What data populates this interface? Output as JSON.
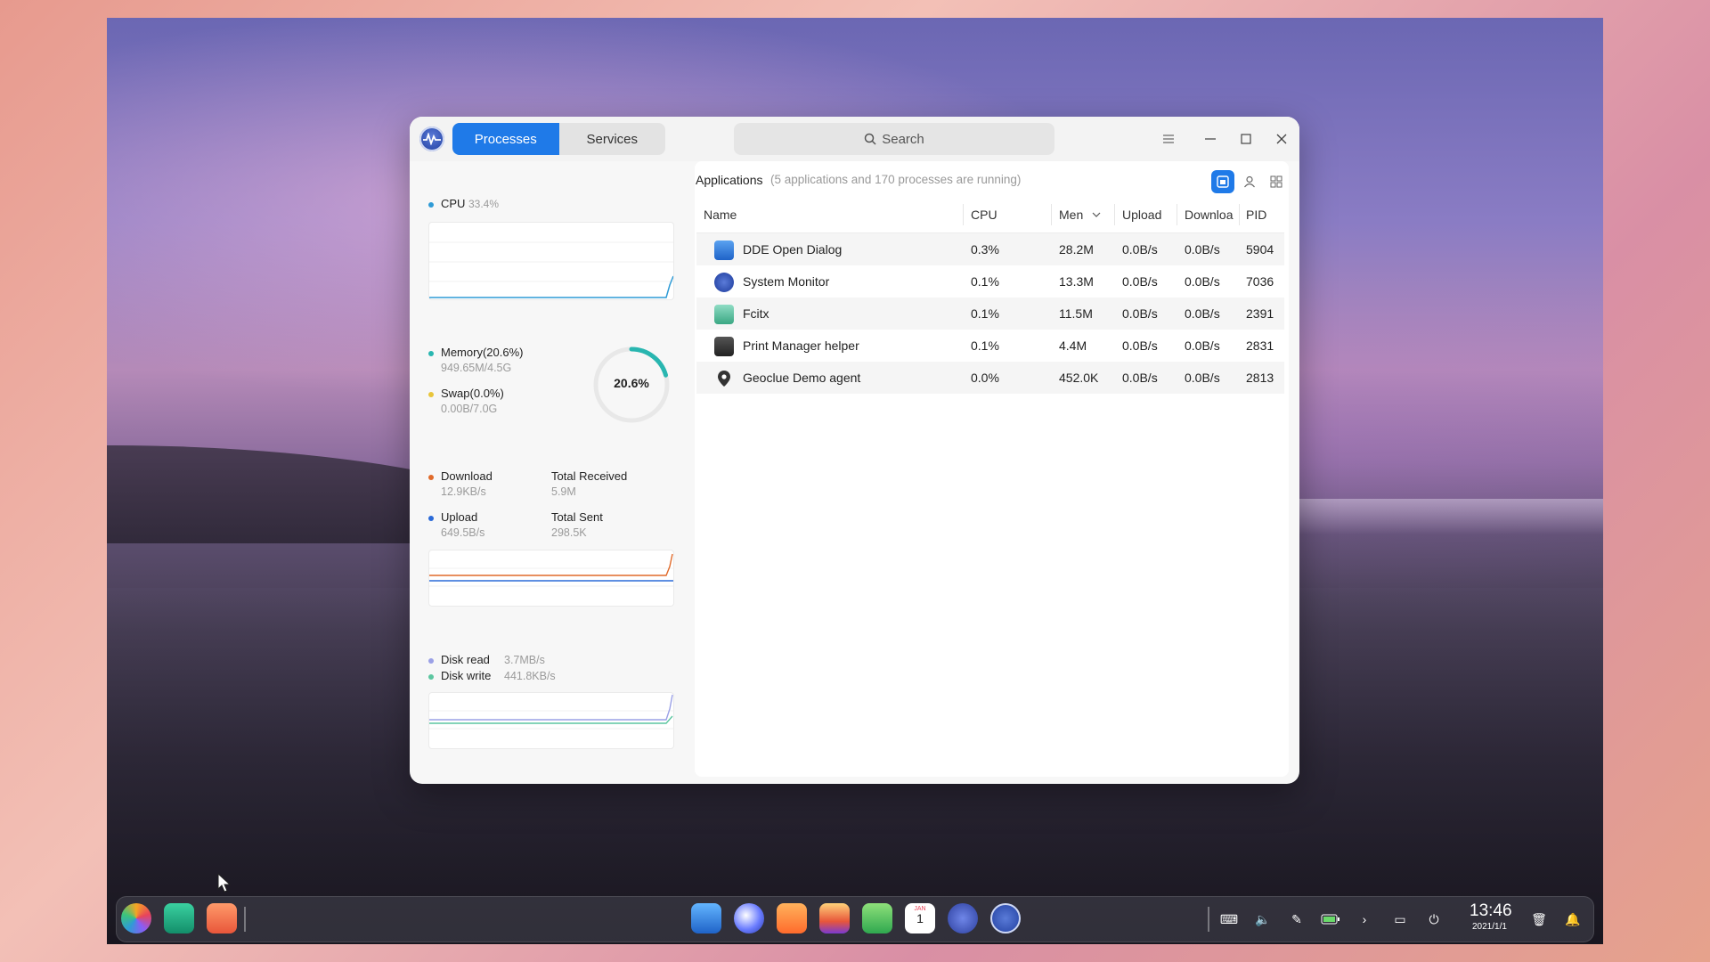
{
  "window": {
    "tabs": [
      {
        "label": "Processes",
        "active": true
      },
      {
        "label": "Services",
        "active": false
      }
    ],
    "search_placeholder": "Search"
  },
  "left": {
    "cpu": {
      "label": "CPU",
      "value": "33.4%"
    },
    "memory": {
      "label": "Memory(20.6%)",
      "detail": "949.65M/4.5G",
      "ring": "20.6%",
      "ring_fraction": 0.206
    },
    "swap": {
      "label": "Swap(0.0%)",
      "detail": "0.00B/7.0G"
    },
    "network": {
      "download_label": "Download",
      "download_value": "12.9KB/s",
      "upload_label": "Upload",
      "upload_value": "649.5B/s",
      "total_received_label": "Total Received",
      "total_received_value": "5.9M",
      "total_sent_label": "Total Sent",
      "total_sent_value": "298.5K"
    },
    "disk": {
      "read_label": "Disk read",
      "read_value": "3.7MB/s",
      "write_label": "Disk write",
      "write_value": "441.8KB/s"
    }
  },
  "right": {
    "header_title": "Applications",
    "header_sub": "(5 applications and 170 processes are running)",
    "columns": [
      "Name",
      "CPU",
      "Men",
      "Upload",
      "Downloa",
      "PID"
    ],
    "rows": [
      {
        "name": "DDE Open Dialog",
        "cpu": "0.3%",
        "mem": "28.2M",
        "upload": "0.0B/s",
        "download": "0.0B/s",
        "pid": "5904"
      },
      {
        "name": "System Monitor",
        "cpu": "0.1%",
        "mem": "13.3M",
        "upload": "0.0B/s",
        "download": "0.0B/s",
        "pid": "7036"
      },
      {
        "name": "Fcitx",
        "cpu": "0.1%",
        "mem": "11.5M",
        "upload": "0.0B/s",
        "download": "0.0B/s",
        "pid": "2391"
      },
      {
        "name": "Print Manager helper",
        "cpu": "0.1%",
        "mem": "4.4M",
        "upload": "0.0B/s",
        "download": "0.0B/s",
        "pid": "2831"
      },
      {
        "name": "Geoclue Demo agent",
        "cpu": "0.0%",
        "mem": "452.0K",
        "upload": "0.0B/s",
        "download": "0.0B/s",
        "pid": "2813"
      }
    ]
  },
  "dock": {
    "time": "13:46",
    "date": "2021/1/1",
    "calendar_month": "JAN",
    "calendar_day": "1"
  },
  "colors": {
    "accent": "#1f7ae8",
    "cpu": "#2f9bd6",
    "memory": "#29b6b0",
    "swap": "#e8c53a",
    "download": "#e06a2a",
    "upload": "#2a6ad8",
    "disk_read": "#9aa0e6",
    "disk_write": "#5cc6a0"
  }
}
